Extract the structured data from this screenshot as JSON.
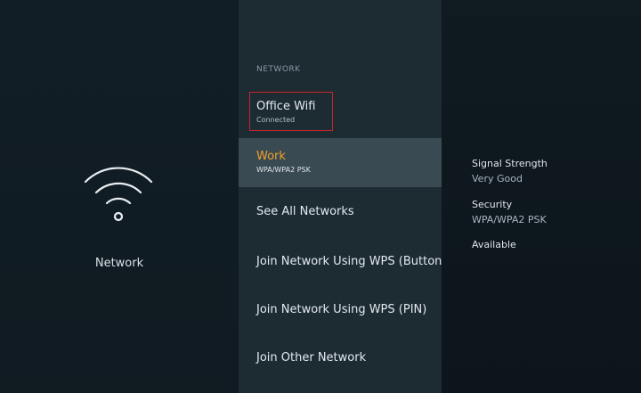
{
  "left_panel": {
    "icon": "wifi-icon",
    "label": "Network"
  },
  "menu": {
    "heading": "NETWORK",
    "items": [
      {
        "title": "Office Wifi",
        "subtitle": "Connected"
      },
      {
        "title": "Work",
        "subtitle": "WPA/WPA2 PSK"
      },
      {
        "title": "See All Networks"
      },
      {
        "title": "Join Network Using WPS (Button)"
      },
      {
        "title": "Join Network Using WPS (PIN)"
      },
      {
        "title": "Join Other Network"
      }
    ]
  },
  "details": {
    "signal_label": "Signal Strength",
    "signal_value": "Very Good",
    "security_label": "Security",
    "security_value": "WPA/WPA2 PSK",
    "status": "Available"
  },
  "colors": {
    "focus_accent": "#f0a12a",
    "selection_outline": "#c8262c"
  }
}
